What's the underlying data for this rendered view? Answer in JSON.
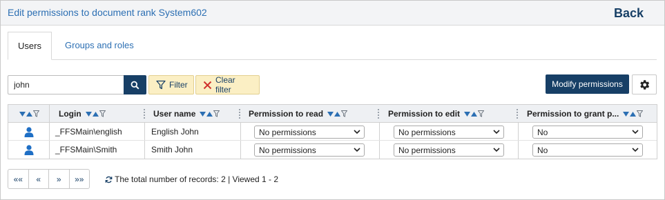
{
  "header": {
    "title": "Edit permissions to document rank System602",
    "back_label": "Back"
  },
  "tabs": [
    {
      "label": "Users",
      "active": true
    },
    {
      "label": "Groups and roles",
      "active": false
    }
  ],
  "toolbar": {
    "search_value": "john",
    "filter_label": "Filter",
    "clear_filter_label": "Clear filter",
    "modify_label": "Modify permissions"
  },
  "grid": {
    "columns": [
      {
        "label": ""
      },
      {
        "label": "Login"
      },
      {
        "label": "User name"
      },
      {
        "label": "Permission to read"
      },
      {
        "label": "Permission to edit"
      },
      {
        "label": "Permission to grant p..."
      }
    ],
    "rows": [
      {
        "login": "_FFSMain\\english",
        "username": "English John",
        "read": "No permissions",
        "edit": "No permissions",
        "grant": "No"
      },
      {
        "login": "_FFSMain\\Smith",
        "username": "Smith John",
        "read": "No permissions",
        "edit": "No permissions",
        "grant": "No"
      }
    ]
  },
  "pager": {
    "first": "««",
    "prev": "«",
    "next": "»",
    "last": "»»"
  },
  "status": {
    "text": "The total number of records: 2 | Viewed 1 - 2"
  },
  "colors": {
    "brand_dark": "#173f66",
    "link_blue": "#2c6fb3",
    "filter_bg": "#fbefc4",
    "user_icon": "#1f6fc5",
    "clear_x": "#d0312d"
  }
}
